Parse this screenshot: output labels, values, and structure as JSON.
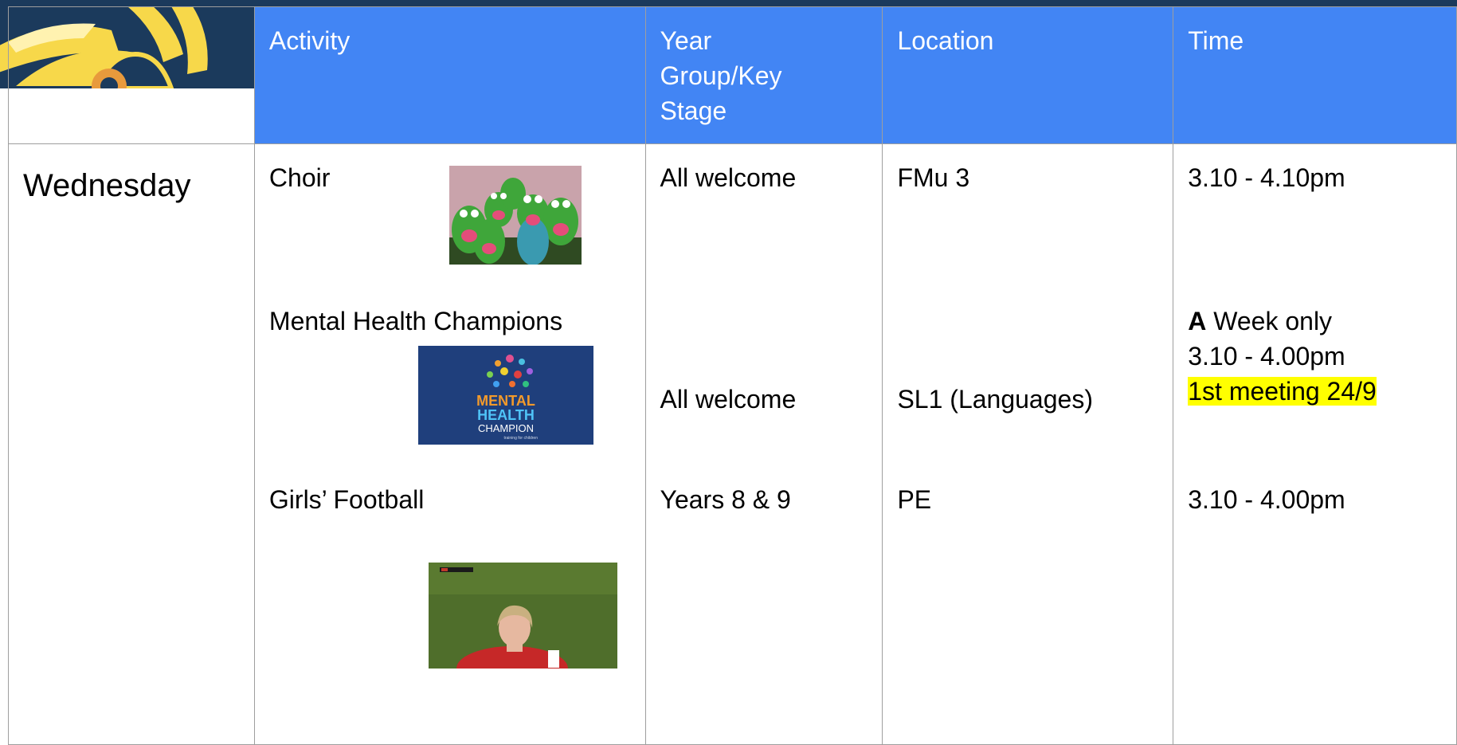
{
  "header": {
    "activity": "Activity",
    "year_group": "Year Group/Key Stage",
    "location": "Location",
    "time": "Time"
  },
  "day": "Wednesday",
  "rows": [
    {
      "activity": "Choir",
      "year_group": "All welcome",
      "location": "FMu 3",
      "time_lines": [
        "3.10 - 4.10pm"
      ],
      "image": "frog-choir-photo"
    },
    {
      "activity": "Mental Health Champions",
      "year_group": "All welcome",
      "location": "SL1 (Languages)",
      "time_prefix_bold": "A",
      "time_line1_rest": " Week only",
      "time_line2": "3.10 - 4.00pm",
      "time_highlight": "1st meeting 24/9",
      "image": "mental-health-champion-logo",
      "logo_text": [
        "MENTAL",
        "HEALTH",
        "CHAMPION",
        "training for children"
      ]
    },
    {
      "activity": "Girls’ Football",
      "year_group": "Years 8 & 9",
      "location": "PE",
      "time_lines": [
        "3.10 - 4.00pm"
      ],
      "image": "football-player-photo"
    }
  ],
  "colors": {
    "header_bg": "#4285f4",
    "header_text": "#ffffff",
    "banner_bg": "#1b3a5c",
    "sun_yellow": "#f7d84a",
    "highlight": "#ffff00",
    "border": "#9e9e9e"
  }
}
